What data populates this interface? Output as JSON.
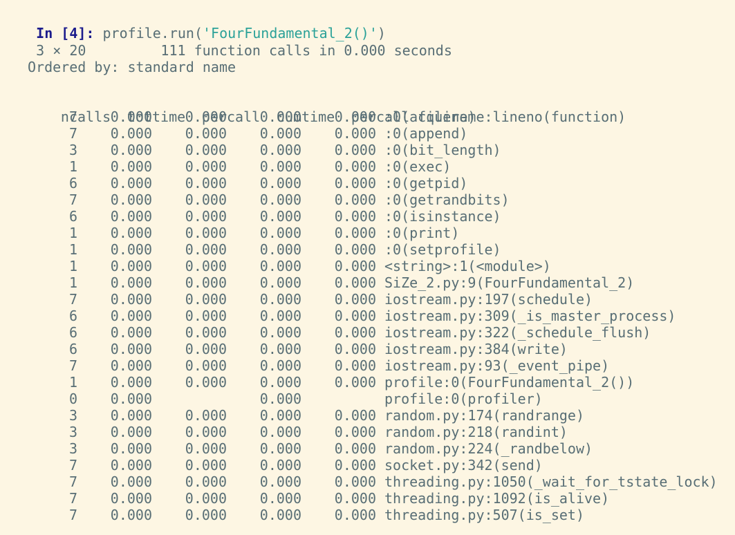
{
  "cell": {
    "prompt_label": "In [4]:",
    "code_prefix": " profile.run(",
    "code_string": "'FourFundamental_2()'",
    "code_suffix": ")"
  },
  "output": {
    "shape": "3 × 20",
    "summary": "111 function calls in 0.000 seconds",
    "ordered_by": "Ordered by: standard name"
  },
  "table": {
    "headers": {
      "ncalls": "ncalls",
      "tottime": "tottime",
      "percall1": "percall",
      "cumtime": "cumtime",
      "percall2": "percall",
      "file": "filename:lineno(function)"
    },
    "rows": [
      {
        "ncalls": "7",
        "tottime": "0.000",
        "percall1": "0.000",
        "cumtime": "0.000",
        "percall2": "0.000",
        "file": ":0(acquire)"
      },
      {
        "ncalls": "7",
        "tottime": "0.000",
        "percall1": "0.000",
        "cumtime": "0.000",
        "percall2": "0.000",
        "file": ":0(append)"
      },
      {
        "ncalls": "3",
        "tottime": "0.000",
        "percall1": "0.000",
        "cumtime": "0.000",
        "percall2": "0.000",
        "file": ":0(bit_length)"
      },
      {
        "ncalls": "1",
        "tottime": "0.000",
        "percall1": "0.000",
        "cumtime": "0.000",
        "percall2": "0.000",
        "file": ":0(exec)"
      },
      {
        "ncalls": "6",
        "tottime": "0.000",
        "percall1": "0.000",
        "cumtime": "0.000",
        "percall2": "0.000",
        "file": ":0(getpid)"
      },
      {
        "ncalls": "7",
        "tottime": "0.000",
        "percall1": "0.000",
        "cumtime": "0.000",
        "percall2": "0.000",
        "file": ":0(getrandbits)"
      },
      {
        "ncalls": "6",
        "tottime": "0.000",
        "percall1": "0.000",
        "cumtime": "0.000",
        "percall2": "0.000",
        "file": ":0(isinstance)"
      },
      {
        "ncalls": "1",
        "tottime": "0.000",
        "percall1": "0.000",
        "cumtime": "0.000",
        "percall2": "0.000",
        "file": ":0(print)"
      },
      {
        "ncalls": "1",
        "tottime": "0.000",
        "percall1": "0.000",
        "cumtime": "0.000",
        "percall2": "0.000",
        "file": ":0(setprofile)"
      },
      {
        "ncalls": "1",
        "tottime": "0.000",
        "percall1": "0.000",
        "cumtime": "0.000",
        "percall2": "0.000",
        "file": "<string>:1(<module>)"
      },
      {
        "ncalls": "1",
        "tottime": "0.000",
        "percall1": "0.000",
        "cumtime": "0.000",
        "percall2": "0.000",
        "file": "SiZe_2.py:9(FourFundamental_2)"
      },
      {
        "ncalls": "7",
        "tottime": "0.000",
        "percall1": "0.000",
        "cumtime": "0.000",
        "percall2": "0.000",
        "file": "iostream.py:197(schedule)"
      },
      {
        "ncalls": "6",
        "tottime": "0.000",
        "percall1": "0.000",
        "cumtime": "0.000",
        "percall2": "0.000",
        "file": "iostream.py:309(_is_master_process)"
      },
      {
        "ncalls": "6",
        "tottime": "0.000",
        "percall1": "0.000",
        "cumtime": "0.000",
        "percall2": "0.000",
        "file": "iostream.py:322(_schedule_flush)"
      },
      {
        "ncalls": "6",
        "tottime": "0.000",
        "percall1": "0.000",
        "cumtime": "0.000",
        "percall2": "0.000",
        "file": "iostream.py:384(write)"
      },
      {
        "ncalls": "7",
        "tottime": "0.000",
        "percall1": "0.000",
        "cumtime": "0.000",
        "percall2": "0.000",
        "file": "iostream.py:93(_event_pipe)"
      },
      {
        "ncalls": "1",
        "tottime": "0.000",
        "percall1": "0.000",
        "cumtime": "0.000",
        "percall2": "0.000",
        "file": "profile:0(FourFundamental_2())"
      },
      {
        "ncalls": "0",
        "tottime": "0.000",
        "percall1": "",
        "cumtime": "0.000",
        "percall2": "",
        "file": "profile:0(profiler)"
      },
      {
        "ncalls": "3",
        "tottime": "0.000",
        "percall1": "0.000",
        "cumtime": "0.000",
        "percall2": "0.000",
        "file": "random.py:174(randrange)"
      },
      {
        "ncalls": "3",
        "tottime": "0.000",
        "percall1": "0.000",
        "cumtime": "0.000",
        "percall2": "0.000",
        "file": "random.py:218(randint)"
      },
      {
        "ncalls": "3",
        "tottime": "0.000",
        "percall1": "0.000",
        "cumtime": "0.000",
        "percall2": "0.000",
        "file": "random.py:224(_randbelow)"
      },
      {
        "ncalls": "7",
        "tottime": "0.000",
        "percall1": "0.000",
        "cumtime": "0.000",
        "percall2": "0.000",
        "file": "socket.py:342(send)"
      },
      {
        "ncalls": "7",
        "tottime": "0.000",
        "percall1": "0.000",
        "cumtime": "0.000",
        "percall2": "0.000",
        "file": "threading.py:1050(_wait_for_tstate_lock)"
      },
      {
        "ncalls": "7",
        "tottime": "0.000",
        "percall1": "0.000",
        "cumtime": "0.000",
        "percall2": "0.000",
        "file": "threading.py:1092(is_alive)"
      },
      {
        "ncalls": "7",
        "tottime": "0.000",
        "percall1": "0.000",
        "cumtime": "0.000",
        "percall2": "0.000",
        "file": "threading.py:507(is_set)"
      }
    ]
  }
}
